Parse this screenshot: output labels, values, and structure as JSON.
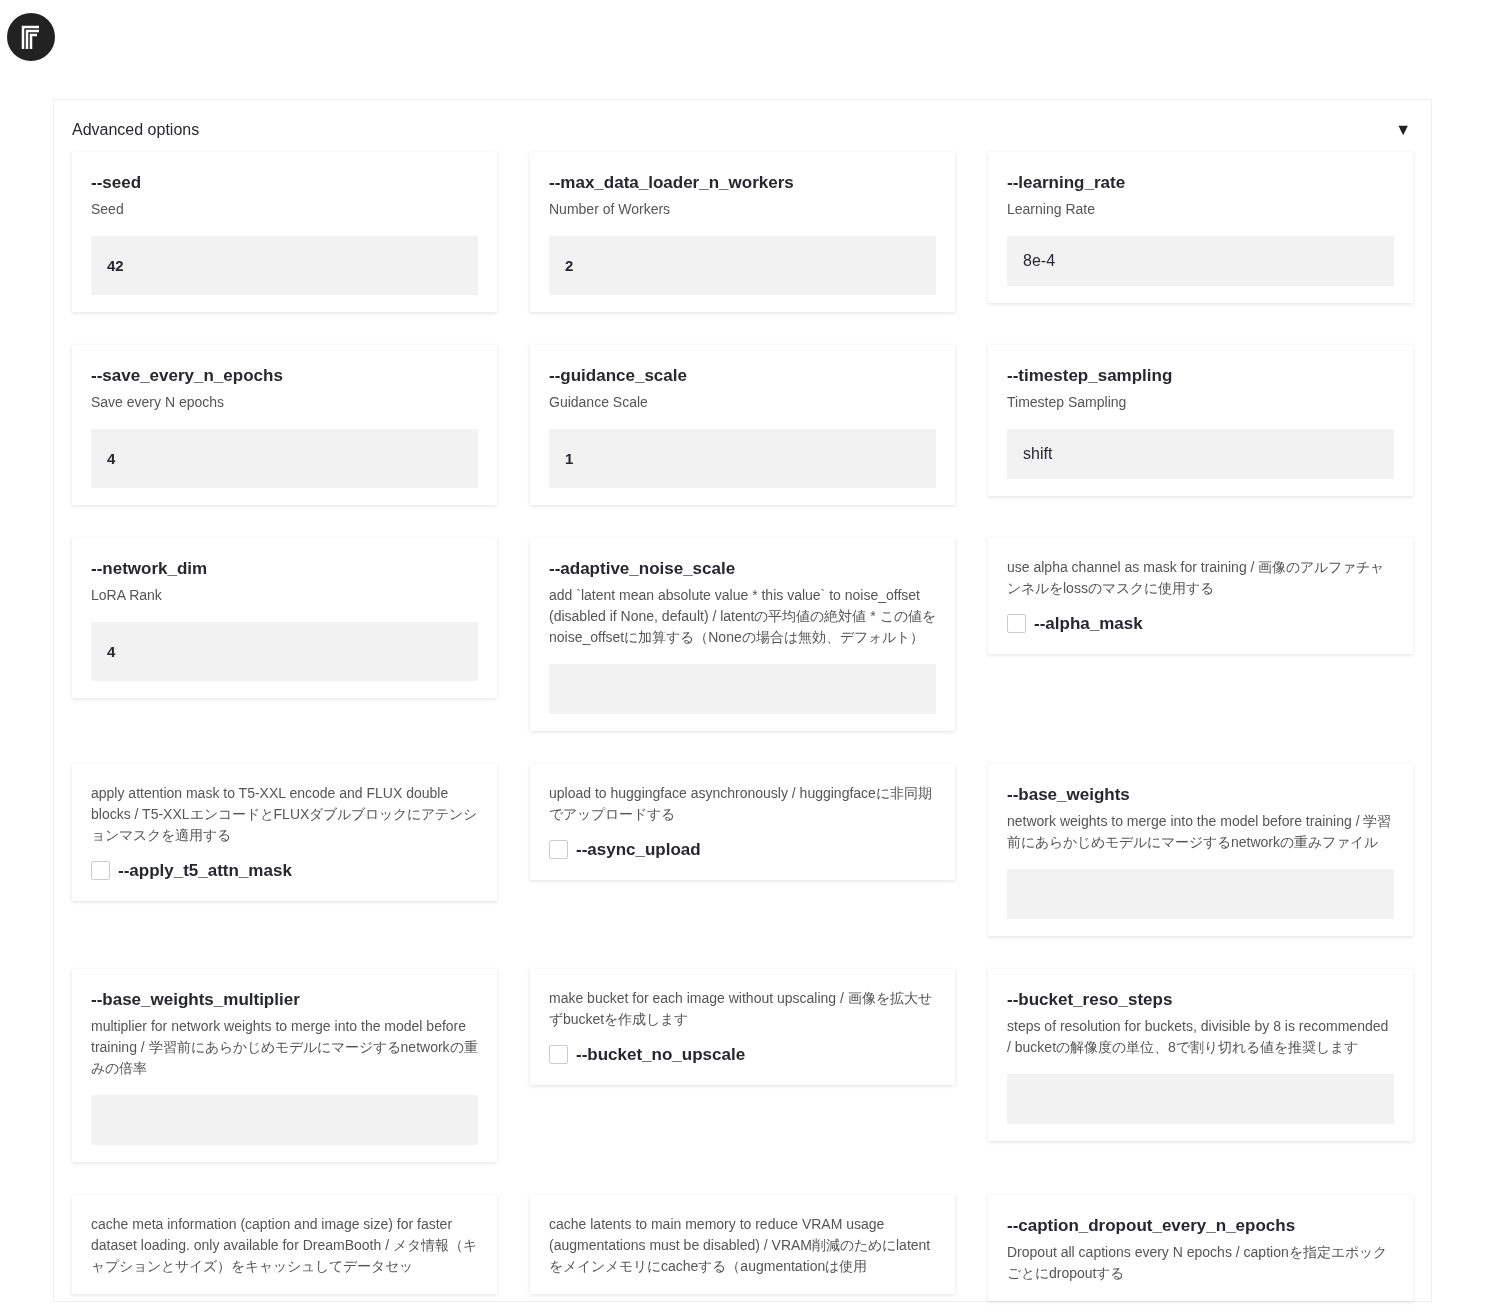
{
  "panel": {
    "title": "Advanced options",
    "toggle": "▼",
    "expanded": true
  },
  "cards": [
    {
      "kind": "number",
      "title": "--seed",
      "description": "Seed",
      "value": "42"
    },
    {
      "kind": "number",
      "title": "--max_data_loader_n_workers",
      "description": "Number of Workers",
      "value": "2"
    },
    {
      "kind": "text",
      "title": "--learning_rate",
      "description": "Learning Rate",
      "value": "8e-4"
    },
    {
      "kind": "number",
      "title": "--save_every_n_epochs",
      "description": "Save every N epochs",
      "value": "4"
    },
    {
      "kind": "number",
      "title": "--guidance_scale",
      "description": "Guidance Scale",
      "value": "1"
    },
    {
      "kind": "text",
      "title": "--timestep_sampling",
      "description": "Timestep Sampling",
      "value": "shift"
    },
    {
      "kind": "number",
      "title": "--network_dim",
      "description": "LoRA Rank",
      "value": "4"
    },
    {
      "kind": "text",
      "title": "--adaptive_noise_scale",
      "description": "add `latent mean absolute value * this value` to noise_offset (disabled if None, default) / latentの平均値の絶対値 * この値をnoise_offsetに加算する（Noneの場合は無効、デフォルト）"
    },
    {
      "kind": "checkbox",
      "title": "--alpha_mask",
      "description": "use alpha channel as mask for training / 画像のアルファチャンネルをlossのマスクに使用する",
      "checked": false
    },
    {
      "kind": "checkbox",
      "title": "--apply_t5_attn_mask",
      "description": "apply attention mask to T5-XXL encode and FLUX double blocks / T5-XXLエンコードとFLUXダブルブロックにアテンションマスクを適用する",
      "checked": false
    },
    {
      "kind": "checkbox",
      "title": "--async_upload",
      "description": "upload to huggingface asynchronously / huggingfaceに非同期でアップロードする",
      "checked": false
    },
    {
      "kind": "text",
      "title": "--base_weights",
      "description": "network weights to merge into the model before training / 学習前にあらかじめモデルにマージするnetworkの重みファイル"
    },
    {
      "kind": "text",
      "title": "--base_weights_multiplier",
      "description": "multiplier for network weights to merge into the model before training / 学習前にあらかじめモデルにマージするnetworkの重みの倍率"
    },
    {
      "kind": "checkbox",
      "title": "--bucket_no_upscale",
      "description": "make bucket for each image without upscaling / 画像を拡大せずbucketを作成します",
      "checked": false
    },
    {
      "kind": "text",
      "title": "--bucket_reso_steps",
      "description": "steps of resolution for buckets, divisible by 8 is recommended / bucketの解像度の単位、8で割り切れる値を推奨します"
    },
    {
      "kind": "partial",
      "description": "cache meta information (caption and image size) for faster dataset loading. only available for DreamBooth / メタ情報（キャプションとサイズ）をキャッシュしてデータセッ"
    },
    {
      "kind": "partial",
      "description": "cache latents to main memory to reduce VRAM usage (augmentations must be disabled) / VRAM削減のためにlatentをメインメモリにcacheする（augmentationは使用"
    },
    {
      "kind": "text_partial",
      "title": "--caption_dropout_every_n_epochs",
      "description": "Dropout all captions every N epochs / captionを指定エポックごとにdropoutする"
    }
  ]
}
